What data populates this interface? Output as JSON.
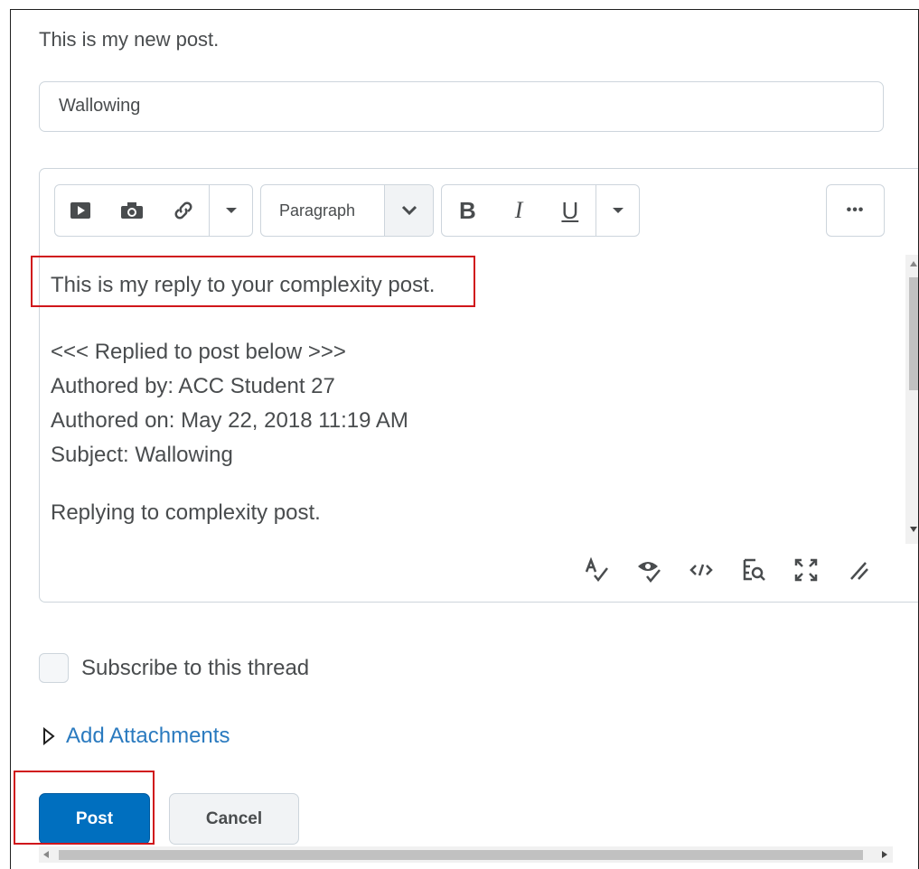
{
  "intro_text": "This is my new post.",
  "subject": {
    "value": "Wallowing"
  },
  "toolbar": {
    "insert_stuff_icon": "video-play-icon",
    "insert_image_icon": "camera-icon",
    "insert_link_icon": "link-icon",
    "more_insert_icon": "caret-down-icon",
    "format_label": "Paragraph",
    "bold_label": "B",
    "italic_label": "I",
    "underline_label": "U",
    "more_format_icon": "caret-down-icon",
    "more_actions_label": "•••"
  },
  "editor": {
    "reply_line": "This is my reply to your complexity post.",
    "quoted": [
      "<<< Replied to post below >>>",
      "Authored by: ACC Student 27",
      "Authored on: May 22, 2018 11:19 AM",
      "Subject: Wallowing"
    ],
    "original": "Replying to complexity post."
  },
  "editor_footer_icons": [
    "spellcheck-icon",
    "accessibility-check-icon",
    "source-code-icon",
    "preview-icon",
    "fullscreen-icon",
    "resize-handle-icon"
  ],
  "subscribe_label": "Subscribe to this thread",
  "attachments_label": "Add Attachments",
  "buttons": {
    "post": "Post",
    "cancel": "Cancel"
  },
  "colors": {
    "primary": "#006fbf",
    "link": "#2a7abf",
    "highlight": "#d0161b"
  }
}
